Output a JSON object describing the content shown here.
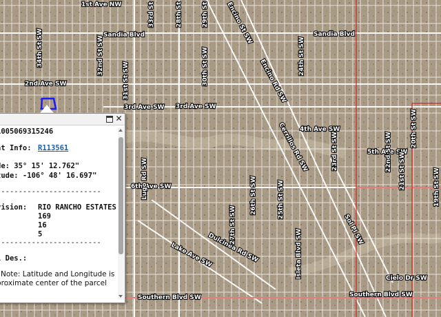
{
  "map": {
    "streets": [
      "1st Ave NW",
      "Sandia Blvd",
      "Sandia Blvd",
      "2nd Ave SW",
      "3rd Ave SW",
      "3rd Ave SW",
      "4th Ave SW",
      "5th Ave SW",
      "6th Ave SW",
      "Southern Blvd SW",
      "Southern Blvd SW",
      "Dulcinea Rd SW",
      "Lake Ave SW",
      "Cielo Dr SW",
      "34th St SW",
      "32nd St SW",
      "31st St SW",
      "30th St SW",
      "28th St SW",
      "27th St SW",
      "26th St SW",
      "25th St SW",
      "24th St SW",
      "23rd St SW",
      "22nd St SW",
      "21st St SW",
      "20th St SW",
      "19th St SW",
      "33rd St SW",
      "29th St SW",
      "Encino St SW",
      "Encino Rd SW",
      "Cerrillos Rd SW",
      "Isleta Blvd SW",
      "Sol Pl SW",
      "Lugo Rd SW"
    ]
  },
  "popup": {
    "title_controls": {
      "maximize": "maximize",
      "close": "✕"
    },
    "lines": {
      "parcel_id": "1005069315246",
      "account_label": "nt Info:",
      "account_value": "R113561",
      "latitude": "de: 35° 15' 12.762\"",
      "longitude": "tude: -106° 48' 16.697\"",
      "divider1": "------------------------",
      "subdivision_label": "vision:",
      "subdivision_value": "RIO RANCHO ESTATES",
      "value1": "169",
      "value2_label": ":",
      "value2": "16",
      "value3": "5",
      "divider2": "------------------------",
      "legal_label": "l Des.:",
      "note1": "Note: Latitude and Longitude is",
      "note2": "proximate center of the parcel",
      "note3": "."
    }
  },
  "colors": {
    "imagery": "#a99a85",
    "road": "#ffffff",
    "boundary": "#d32020",
    "highlight": "#1a1aff",
    "link": "#1a5fa8"
  }
}
